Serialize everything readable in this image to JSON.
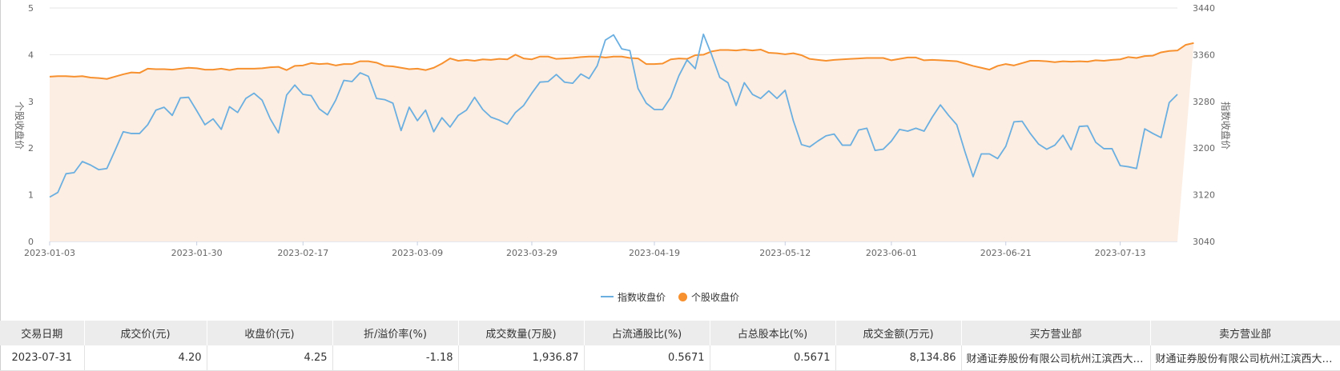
{
  "chart_data": {
    "type": "line",
    "y_left": {
      "label": "个股收盘价",
      "min": 0,
      "max": 5,
      "ticks": [
        "0",
        "1",
        "2",
        "3",
        "4",
        "5"
      ]
    },
    "y_right": {
      "label": "指数收盘价",
      "min": 3040,
      "max": 3440,
      "ticks": [
        "3040",
        "3120",
        "3200",
        "3280",
        "3360",
        "3440"
      ]
    },
    "x_labels": [
      "2023-01-03",
      "2023-01-30",
      "2023-02-17",
      "2023-03-09",
      "2023-03-29",
      "2023-04-19",
      "2023-05-12",
      "2023-06-01",
      "2023-06-21",
      "2023-07-13"
    ],
    "x_label_index": [
      0,
      18,
      31,
      45,
      59,
      74,
      90,
      103,
      117,
      131
    ],
    "grid": true,
    "legend_position": "bottom",
    "series": [
      {
        "name": "指数收盘价",
        "axis": "right",
        "color": "#6aafe0",
        "values": [
          3116,
          3124,
          3156,
          3158,
          3177,
          3171,
          3163,
          3165,
          3196,
          3228,
          3225,
          3225,
          3240,
          3265,
          3270,
          3256,
          3286,
          3287,
          3264,
          3240,
          3250,
          3232,
          3271,
          3261,
          3285,
          3294,
          3282,
          3250,
          3226,
          3291,
          3308,
          3292,
          3290,
          3267,
          3257,
          3282,
          3316,
          3314,
          3329,
          3323,
          3285,
          3283,
          3277,
          3230,
          3270,
          3247,
          3265,
          3228,
          3252,
          3236,
          3256,
          3265,
          3287,
          3266,
          3253,
          3248,
          3241,
          3261,
          3273,
          3294,
          3313,
          3314,
          3326,
          3313,
          3311,
          3327,
          3319,
          3341,
          3385,
          3394,
          3370,
          3367,
          3302,
          3277,
          3266,
          3266,
          3287,
          3324,
          3351,
          3336,
          3395,
          3360,
          3321,
          3312,
          3273,
          3312,
          3292,
          3285,
          3298,
          3285,
          3299,
          3247,
          3206,
          3202,
          3212,
          3221,
          3224,
          3205,
          3205,
          3231,
          3234,
          3196,
          3198,
          3212,
          3232,
          3229,
          3234,
          3229,
          3253,
          3274,
          3256,
          3240,
          3194,
          3151,
          3190,
          3190,
          3182,
          3203,
          3245,
          3246,
          3225,
          3207,
          3198,
          3205,
          3222,
          3197,
          3237,
          3238,
          3210,
          3199,
          3199,
          3170,
          3168,
          3165,
          3233,
          3225,
          3218,
          3278,
          3292
        ]
      },
      {
        "name": "个股收盘价",
        "axis": "left",
        "color": "#f7902e",
        "values": [
          3.53,
          3.54,
          3.54,
          3.53,
          3.54,
          3.51,
          3.5,
          3.48,
          3.53,
          3.58,
          3.62,
          3.61,
          3.7,
          3.69,
          3.69,
          3.68,
          3.7,
          3.72,
          3.71,
          3.68,
          3.68,
          3.7,
          3.67,
          3.7,
          3.7,
          3.7,
          3.71,
          3.73,
          3.74,
          3.67,
          3.76,
          3.77,
          3.82,
          3.8,
          3.81,
          3.77,
          3.8,
          3.8,
          3.86,
          3.86,
          3.83,
          3.76,
          3.75,
          3.72,
          3.69,
          3.7,
          3.67,
          3.72,
          3.81,
          3.92,
          3.87,
          3.89,
          3.87,
          3.9,
          3.89,
          3.91,
          3.9,
          4.0,
          3.92,
          3.9,
          3.96,
          3.96,
          3.91,
          3.92,
          3.93,
          3.95,
          3.96,
          3.96,
          3.94,
          3.96,
          3.96,
          3.93,
          3.92,
          3.8,
          3.8,
          3.81,
          3.9,
          3.92,
          3.91,
          3.99,
          4.0,
          4.07,
          4.1,
          4.1,
          4.09,
          4.11,
          4.09,
          4.11,
          4.04,
          4.03,
          4.01,
          4.03,
          3.99,
          3.91,
          3.89,
          3.87,
          3.89,
          3.9,
          3.91,
          3.92,
          3.93,
          3.93,
          3.93,
          3.88,
          3.91,
          3.94,
          3.94,
          3.88,
          3.89,
          3.88,
          3.87,
          3.86,
          3.81,
          3.76,
          3.72,
          3.68,
          3.76,
          3.8,
          3.77,
          3.82,
          3.87,
          3.87,
          3.86,
          3.84,
          3.86,
          3.85,
          3.86,
          3.85,
          3.88,
          3.87,
          3.89,
          3.9,
          3.95,
          3.93,
          3.97,
          3.98,
          4.05,
          4.08,
          4.09,
          4.21,
          4.25
        ]
      }
    ]
  },
  "legend": {
    "item1": "指数收盘价",
    "item2": "个股收盘价"
  },
  "table": {
    "headers": [
      "交易日期",
      "成交价(元)",
      "收盘价(元)",
      "折/溢价率(%)",
      "成交数量(万股)",
      "占流通股比(%)",
      "占总股本比(%)",
      "成交金额(万元)",
      "买方营业部",
      "卖方营业部"
    ],
    "rows": [
      [
        "2023-07-31",
        "4.20",
        "4.25",
        "-1.18",
        "1,936.87",
        "0.5671",
        "0.5671",
        "8,134.86",
        "财通证券股份有限公司杭州江滨西大道证券营业部",
        "财通证券股份有限公司杭州江滨西大道证券营业部"
      ]
    ]
  }
}
